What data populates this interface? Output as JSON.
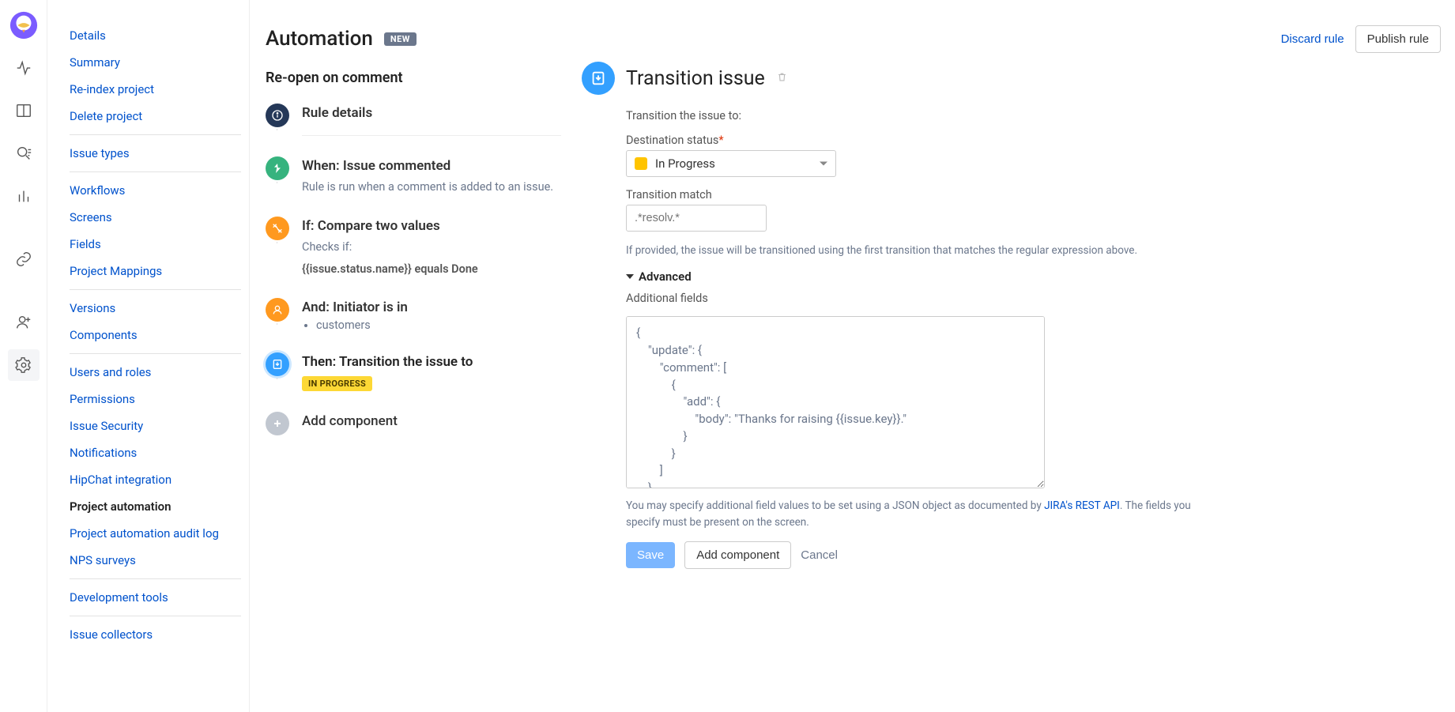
{
  "sidebar": {
    "groups": [
      [
        "Details",
        "Summary",
        "Re-index project",
        "Delete project"
      ],
      [
        "Issue types"
      ],
      [
        "Workflows",
        "Screens",
        "Fields",
        "Project Mappings"
      ],
      [
        "Versions",
        "Components"
      ],
      [
        "Users and roles",
        "Permissions",
        "Issue Security",
        "Notifications",
        "HipChat integration",
        "Project automation",
        "Project automation audit log",
        "NPS surveys"
      ],
      [
        "Development tools"
      ],
      [
        "Issue collectors"
      ]
    ],
    "selected": "Project automation"
  },
  "header": {
    "title": "Automation",
    "badge": "NEW",
    "discard": "Discard rule",
    "publish": "Publish rule"
  },
  "rule": {
    "name": "Re-open on comment",
    "steps": {
      "details": "Rule details",
      "when_title": "When: Issue commented",
      "when_desc": "Rule is run when a comment is added to an issue.",
      "if_title": "If: Compare two values",
      "if_desc1": "Checks if:",
      "if_desc2": "{{issue.status.name}} equals Done",
      "and_title": "And: Initiator is in",
      "and_item": "customers",
      "then_title": "Then: Transition the issue to",
      "then_status": "IN PROGRESS",
      "add": "Add component"
    }
  },
  "panel": {
    "title": "Transition issue",
    "intro": "Transition the issue to:",
    "dest_label": "Destination status",
    "dest_value": "In Progress",
    "match_label": "Transition match",
    "match_placeholder": ".*resolv.*",
    "match_help": "If provided, the issue will be transitioned using the first transition that matches the regular expression above.",
    "advanced": "Advanced",
    "addl_label": "Additional fields",
    "code": "{\n    \"update\": {\n        \"comment\": [\n            {\n                \"add\": {\n                    \"body\": \"Thanks for raising {{issue.key}}.\"\n                }\n            }\n        ]\n    },",
    "help2_a": "You may specify additional field values to be set using a JSON object as documented by ",
    "help2_link": "JIRA's REST API",
    "help2_b": ". The fields you specify must be present on the screen.",
    "btn_save": "Save",
    "btn_add": "Add component",
    "btn_cancel": "Cancel"
  }
}
